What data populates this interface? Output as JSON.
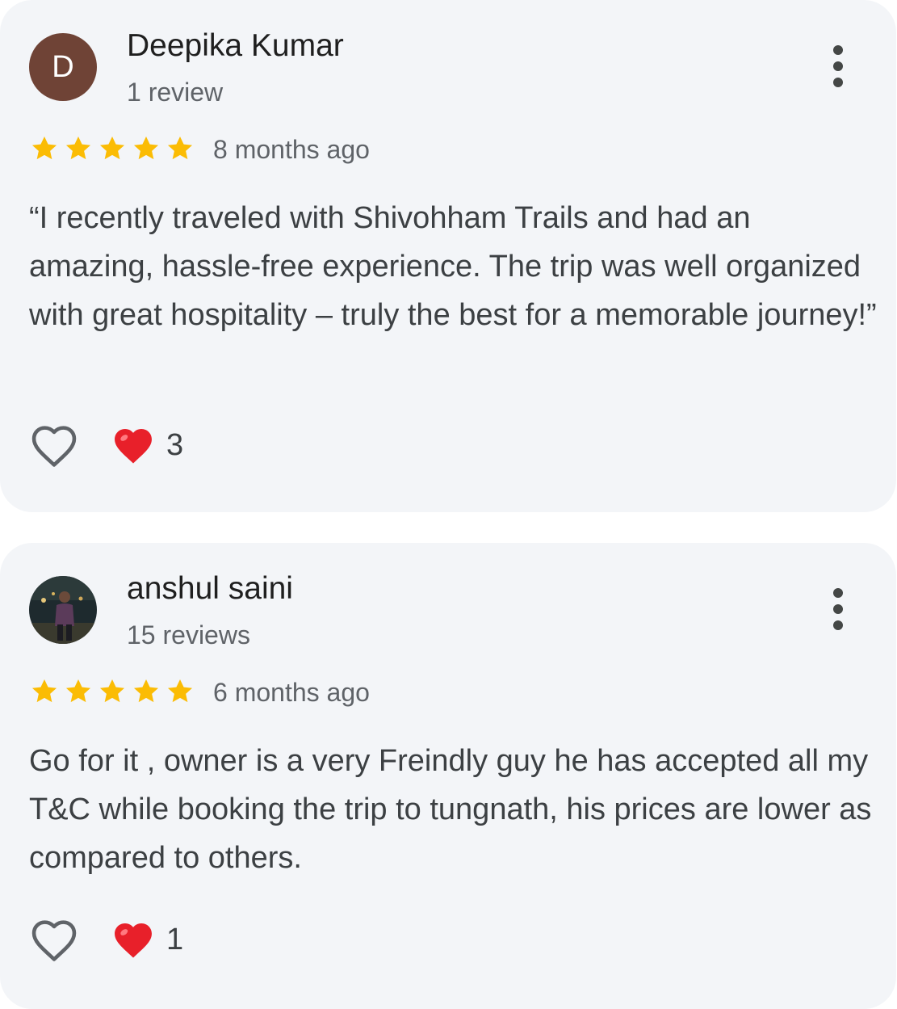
{
  "reviews": [
    {
      "author": "Deepika Kumar",
      "avatar_letter": "D",
      "avatar_color": "#6f4336",
      "review_count": "1 review",
      "rating": 5,
      "time_ago": "8 months ago",
      "text": "“I recently traveled with Shivohham Trails and had an amazing, hassle-free experience. The trip was well organized with great hospitality – truly the best for a memorable journey!”",
      "reaction_count": "3",
      "more_icon": "more-vert-icon",
      "like_icon": "heart-outline-icon",
      "reaction_icon": "red-heart-emoji-icon"
    },
    {
      "author": "anshul saini",
      "avatar": "photo",
      "review_count": "15 reviews",
      "rating": 5,
      "time_ago": "6 months ago",
      "text": "Go for it , owner is a very Freindly guy he has accepted all my T&C while booking the trip to tungnath, his prices are lower as compared to others.",
      "reaction_count": "1",
      "more_icon": "more-vert-icon",
      "like_icon": "heart-outline-icon",
      "reaction_icon": "red-heart-emoji-icon"
    }
  ],
  "colors": {
    "card_background": "#f3f5f8",
    "star": "#fbbc04",
    "secondary_text": "#5f6368",
    "heart": "#e8202a"
  }
}
